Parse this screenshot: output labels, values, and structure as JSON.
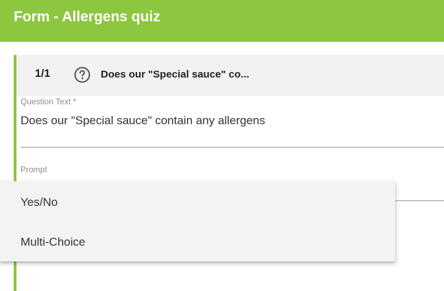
{
  "header": {
    "title": "Form - Allergens quiz"
  },
  "question": {
    "counter": "1/1",
    "help_icon": "help-circle-icon",
    "title": "Does our \"Special sauce\" co..."
  },
  "fields": {
    "question_text": {
      "label": "Question Text *",
      "value": "Does our \"Special sauce\" contain any allergens"
    },
    "prompt": {
      "label": "Prompt"
    }
  },
  "dropdown": {
    "options": [
      "Yes/No",
      "Multi-Choice"
    ]
  },
  "colors": {
    "accent": "#8dc63f",
    "header_text": "#ffffff",
    "panel_bg": "#f2f2f2"
  }
}
